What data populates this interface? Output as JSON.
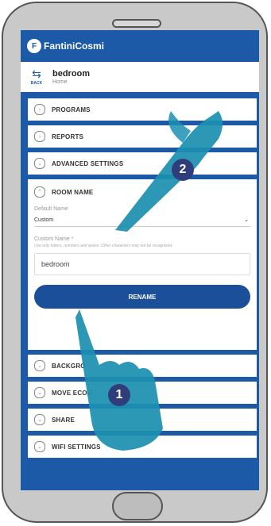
{
  "app": {
    "brand": "FantiniCosmi"
  },
  "room": {
    "back_label": "BACK",
    "title": "bedroom",
    "subtitle": "Home"
  },
  "menu": {
    "programs": "PROGRAMS",
    "reports": "REPORTS",
    "advanced_settings": "ADVANCED SETTINGS",
    "room_name": "ROOM NAME",
    "background": "BACKGRO",
    "move_ecou": "MOVE ECOU",
    "share": "SHARE",
    "wifi_settings": "WIFI SETTINGS"
  },
  "room_name_form": {
    "default_name_label": "Default Name",
    "default_name_value": "Custom",
    "custom_name_label": "Custom Name *",
    "custom_name_help": "Use only letters, numbers and space. Other characters may not be recognized.",
    "custom_name_value": "bedroom",
    "rename_button": "RENAME"
  },
  "annotations": {
    "step1": "1",
    "step2": "2"
  },
  "colors": {
    "brand_blue": "#1c5aa8",
    "badge": "#2f3e7a",
    "hand": "#1b8fb0"
  }
}
